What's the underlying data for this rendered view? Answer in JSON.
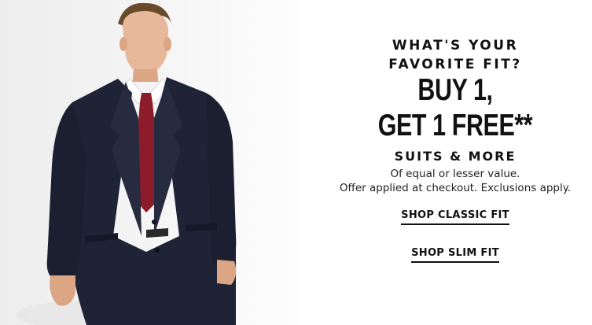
{
  "promo": {
    "eyebrow_line1": "WHAT'S YOUR",
    "eyebrow_line2": "FAVORITE FIT?",
    "headline_line1": "BUY 1,",
    "headline_line2": "GET 1 FREE**",
    "subhead": "SUITS & MORE",
    "note_line1": "Of equal or lesser value.",
    "note_line2": "Offer applied at checkout. Exclusions apply."
  },
  "links": {
    "classic_fit": "SHOP CLASSIC FIT",
    "slim_fit": "SHOP SLIM FIT"
  },
  "colors": {
    "suit": "#1f2336",
    "tie": "#8c1c2a",
    "shirt": "#f4f4f6",
    "text": "#111111"
  }
}
